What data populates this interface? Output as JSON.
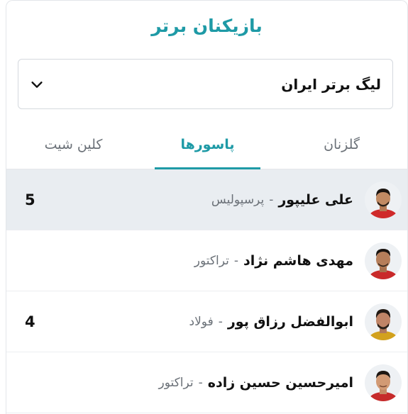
{
  "header": {
    "title": "بازیکنان برتر"
  },
  "league_select": {
    "value": "لیگ برتر ایران",
    "icon": "chevron-down-icon"
  },
  "tabs": [
    {
      "label": "گلزنان",
      "active": false
    },
    {
      "label": "پاسورها",
      "active": true
    },
    {
      "label": "کلین شیت",
      "active": false
    }
  ],
  "separator": "-",
  "players": [
    {
      "name": "علی علیپور",
      "club": "پرسپولیس",
      "score": "5"
    },
    {
      "name": "مهدی هاشم نژاد",
      "club": "تراکتور",
      "score": ""
    },
    {
      "name": "ابوالفضل رزاق پور",
      "club": "فولاد",
      "score": "4"
    },
    {
      "name": "امیرحسین حسین زاده",
      "club": "تراکتور",
      "score": ""
    }
  ],
  "colors": {
    "accent": "#1e9aa6",
    "highlight_row": "#e9edf1"
  }
}
